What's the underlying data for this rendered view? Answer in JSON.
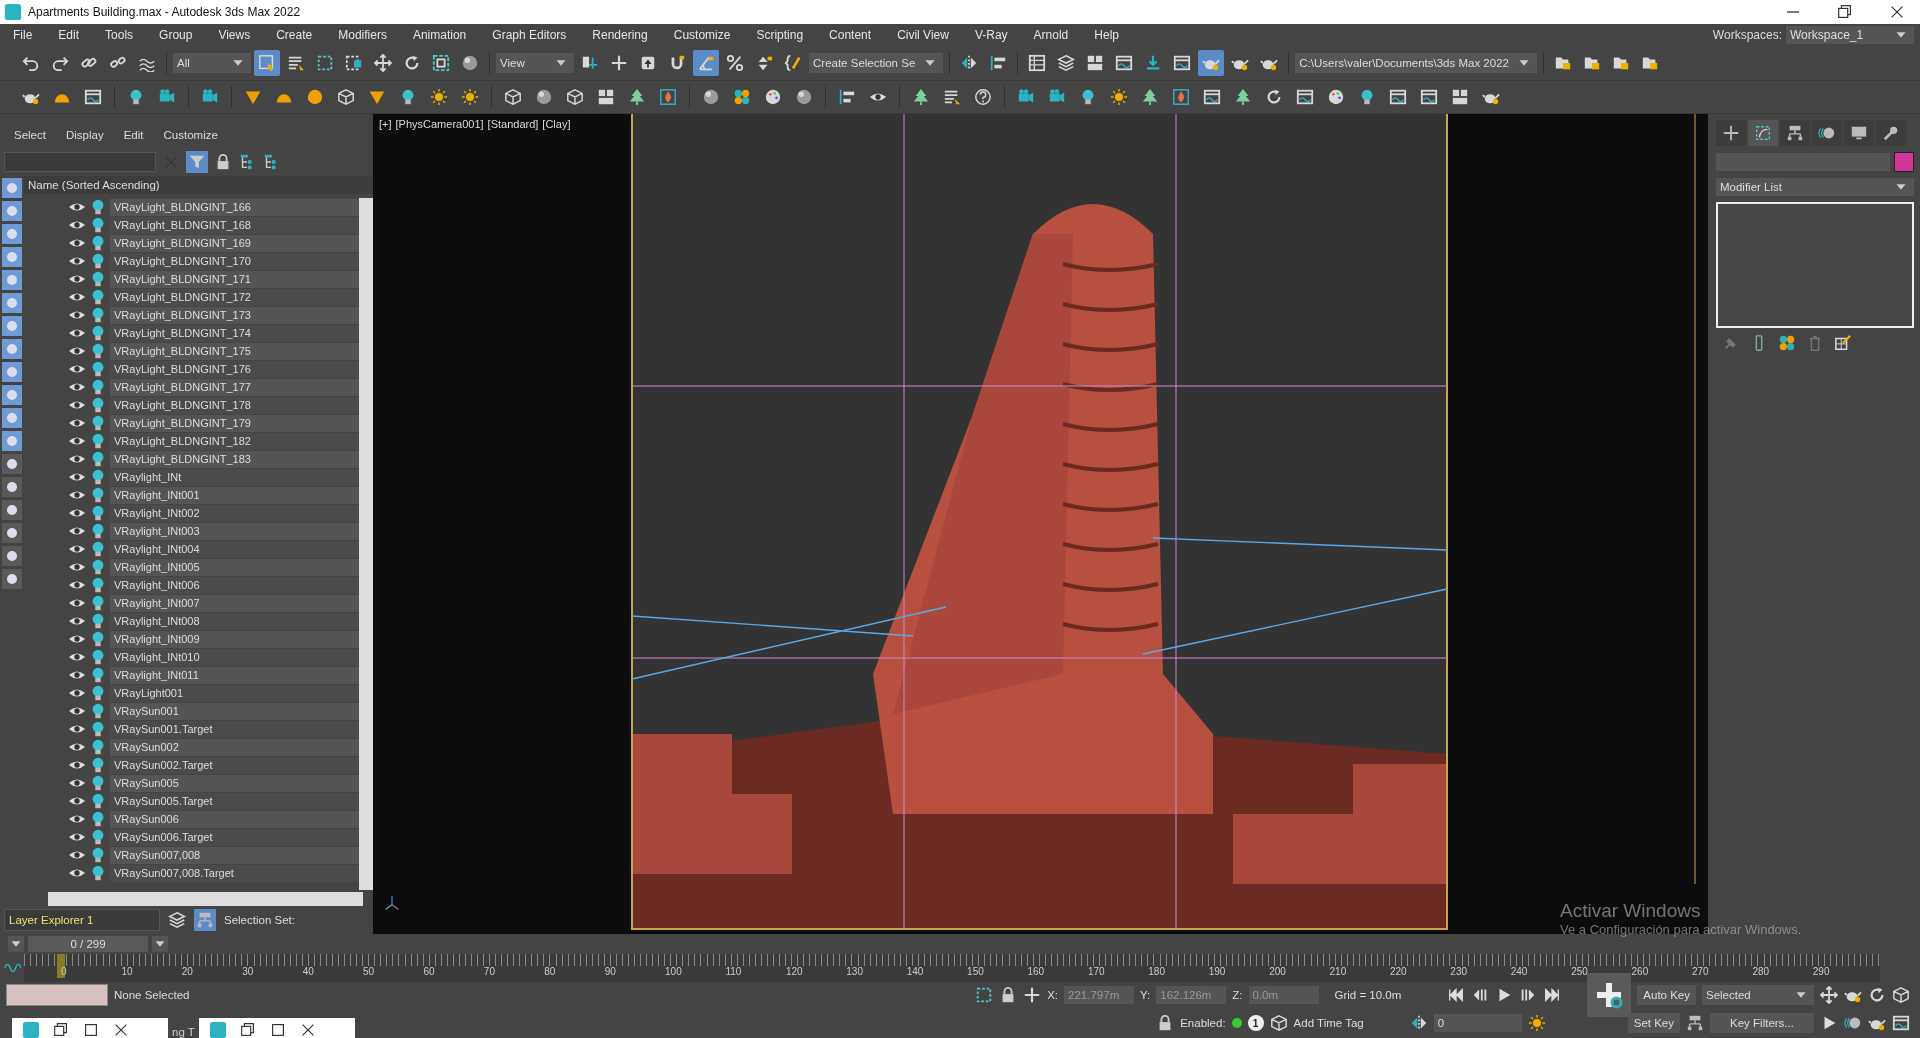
{
  "window": {
    "title": "Apartments Building.max - Autodesk 3ds Max 2022"
  },
  "menu": [
    "File",
    "Edit",
    "Tools",
    "Group",
    "Views",
    "Create",
    "Modifiers",
    "Animation",
    "Graph Editors",
    "Rendering",
    "Customize",
    "Scripting",
    "Content",
    "Civil View",
    "V-Ray",
    "Arnold",
    "Help"
  ],
  "workspaces": {
    "label": "Workspaces:",
    "value": "Workspace_1"
  },
  "main_toolbar": [
    {
      "kind": "undo",
      "selected": false
    },
    {
      "kind": "redo",
      "selected": false
    },
    {
      "kind": "link",
      "selected": false
    },
    {
      "kind": "unlink",
      "selected": false
    },
    {
      "kind": "wave",
      "selected": false
    },
    {
      "kind": "dropdown",
      "value": "All"
    },
    {
      "kind": "cursor",
      "selected": true
    },
    {
      "kind": "list",
      "selected": false
    },
    {
      "kind": "dashed-square",
      "selected": false
    },
    {
      "kind": "window-select",
      "selected": false
    },
    {
      "kind": "move",
      "selected": false
    },
    {
      "kind": "rotate",
      "selected": false
    },
    {
      "kind": "scale",
      "selected": false
    },
    {
      "kind": "sphere",
      "selected": false
    },
    {
      "kind": "dropdown",
      "value": "View"
    },
    {
      "kind": "pivot",
      "selected": false
    },
    {
      "kind": "cross",
      "selected": false
    },
    {
      "kind": "upload",
      "selected": false
    },
    {
      "kind": "magnet",
      "selected": false
    },
    {
      "kind": "angle",
      "selected": true
    },
    {
      "kind": "percent",
      "selected": false
    },
    {
      "kind": "spinner",
      "selected": false
    },
    {
      "kind": "brace",
      "selected": false
    },
    {
      "kind": "dropdown",
      "value": "Create Selection Se"
    },
    {
      "kind": "mirror",
      "selected": false
    },
    {
      "kind": "align",
      "selected": false
    },
    {
      "kind": "table",
      "selected": false
    },
    {
      "kind": "layers",
      "selected": false
    },
    {
      "kind": "grid",
      "selected": false
    },
    {
      "kind": "window",
      "selected": false
    },
    {
      "kind": "download",
      "selected": false
    },
    {
      "kind": "window",
      "selected": false
    },
    {
      "kind": "teapot",
      "selected": true
    },
    {
      "kind": "teapot",
      "selected": false
    },
    {
      "kind": "teapot",
      "selected": false
    },
    {
      "kind": "path",
      "value": "C:\\Users\\valer\\Documents\\3ds Max 2022"
    },
    {
      "kind": "folder",
      "selected": false
    },
    {
      "kind": "folder",
      "selected": false
    },
    {
      "kind": "folder",
      "selected": false
    },
    {
      "kind": "folder",
      "selected": false
    }
  ],
  "explorer": {
    "menu": [
      "Select",
      "Display",
      "Edit",
      "Customize"
    ],
    "column": "Name (Sorted Ascending)",
    "filters": [
      {
        "on": true
      },
      {
        "on": true
      },
      {
        "on": true
      },
      {
        "on": true
      },
      {
        "on": true
      },
      {
        "on": true
      },
      {
        "on": true
      },
      {
        "on": true
      },
      {
        "on": true
      },
      {
        "on": true
      },
      {
        "on": true
      },
      {
        "on": true
      },
      {
        "on": false
      },
      {
        "on": false
      },
      {
        "on": false
      },
      {
        "on": false
      },
      {
        "on": false
      },
      {
        "on": false
      }
    ],
    "items": [
      {
        "name": "VRayLight_BLDNGINT_166"
      },
      {
        "name": "VRayLight_BLDNGINT_168"
      },
      {
        "name": "VRayLight_BLDNGINT_169"
      },
      {
        "name": "VRayLight_BLDNGINT_170"
      },
      {
        "name": "VRayLight_BLDNGINT_171"
      },
      {
        "name": "VRayLight_BLDNGINT_172"
      },
      {
        "name": "VRayLight_BLDNGINT_173"
      },
      {
        "name": "VRayLight_BLDNGINT_174"
      },
      {
        "name": "VRayLight_BLDNGINT_175"
      },
      {
        "name": "VRayLight_BLDNGINT_176"
      },
      {
        "name": "VRayLight_BLDNGINT_177"
      },
      {
        "name": "VRayLight_BLDNGINT_178"
      },
      {
        "name": "VRayLight_BLDNGINT_179"
      },
      {
        "name": "VRayLight_BLDNGINT_182"
      },
      {
        "name": "VRayLight_BLDNGINT_183"
      },
      {
        "name": "VRaylight_INt"
      },
      {
        "name": "VRaylight_INt001"
      },
      {
        "name": "VRaylight_INt002"
      },
      {
        "name": "VRaylight_INt003"
      },
      {
        "name": "VRaylight_INt004"
      },
      {
        "name": "VRaylight_INt005"
      },
      {
        "name": "VRaylight_INt006"
      },
      {
        "name": "VRaylight_INt007"
      },
      {
        "name": "VRaylight_INt008"
      },
      {
        "name": "VRaylight_INt009"
      },
      {
        "name": "VRaylight_INt010"
      },
      {
        "name": "VRaylight_INt011"
      },
      {
        "name": "VRayLight001"
      },
      {
        "name": "VRaySun001"
      },
      {
        "name": "VRaySun001.Target"
      },
      {
        "name": "VRaySun002"
      },
      {
        "name": "VRaySun002.Target"
      },
      {
        "name": "VRaySun005"
      },
      {
        "name": "VRaySun005.Target"
      },
      {
        "name": "VRaySun006"
      },
      {
        "name": "VRaySun006.Target"
      },
      {
        "name": "VRaySun007,008"
      },
      {
        "name": "VRaySun007,008.Target"
      }
    ],
    "layer_explorer": "Layer Explorer 1",
    "selection_set": "Selection Set:"
  },
  "viewport": {
    "labels": [
      "[+]",
      "[PhysCamera001]",
      "[Standard]",
      "[Clay]"
    ]
  },
  "command_panel": {
    "tabs": [
      {
        "kind": "create",
        "selected": false
      },
      {
        "kind": "modify",
        "selected": true
      },
      {
        "kind": "hierarchy",
        "selected": false
      },
      {
        "kind": "motion",
        "selected": false
      },
      {
        "kind": "display",
        "selected": false
      },
      {
        "kind": "utilities",
        "selected": false
      }
    ],
    "modifier_list": "Modifier List"
  },
  "timeline": {
    "frame": "0 / 299",
    "ticks": [
      "0",
      "10",
      "20",
      "30",
      "40",
      "50",
      "60",
      "70",
      "80",
      "90",
      "100",
      "110",
      "120",
      "130",
      "140",
      "150",
      "160",
      "170",
      "180",
      "190",
      "200",
      "210",
      "220",
      "230",
      "240",
      "250",
      "260",
      "270",
      "280",
      "290"
    ]
  },
  "status": {
    "selection": "None Selected",
    "prompt": "ng T",
    "x_label": "X:",
    "x": "221.797m",
    "y_label": "Y:",
    "y": "162.126m",
    "z_label": "Z:",
    "z": "0.0m",
    "grid": "Grid = 10.0m",
    "enabled": "Enabled:",
    "enabled_badge": "1",
    "time_tag": "Add Time Tag",
    "frame_spinner": "0",
    "auto_key": "Auto Key",
    "key_mode": "Selected",
    "set_key": "Set Key",
    "key_filters": "Key Filters..."
  },
  "activation": {
    "title": "Activar Windows",
    "text": "Ve a Configuración para activar Windows."
  }
}
